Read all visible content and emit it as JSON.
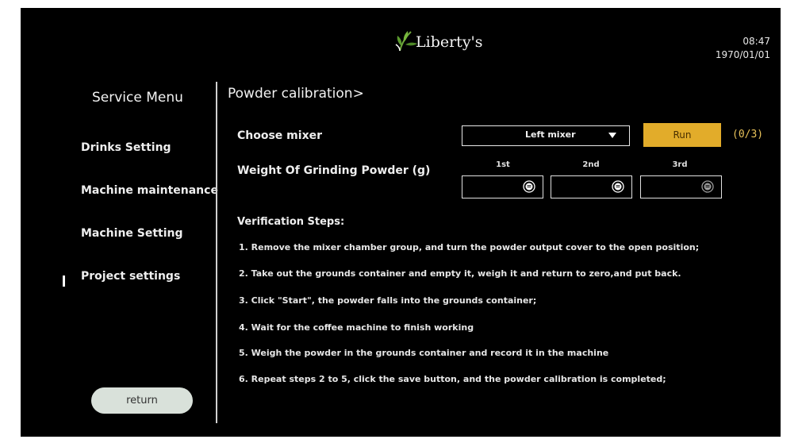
{
  "header": {
    "brand": "Liberty's",
    "time": "08:47",
    "date": "1970/01/01"
  },
  "sidebar": {
    "title": "Service Menu",
    "items": [
      {
        "label": "Drinks Setting"
      },
      {
        "label": "Machine maintenance"
      },
      {
        "label": "Machine Setting"
      },
      {
        "label": "Project settings",
        "active": true
      }
    ],
    "return_label": "return"
  },
  "main": {
    "title": "Powder calibration>",
    "choose_mixer_label": "Choose mixer",
    "mixer_value": "Left mixer",
    "run_label": "Run",
    "counter": "(0/3)",
    "weight_label": "Weight Of Grinding Powder (g)",
    "trials": [
      {
        "label": "1st",
        "value": ""
      },
      {
        "label": "2nd",
        "value": ""
      },
      {
        "label": "3rd",
        "value": ""
      }
    ],
    "steps_title": "Verification Steps:",
    "steps": [
      "1. Remove the mixer chamber group, and turn the powder output cover to the open position;",
      "2. Take out the grounds container and empty it, weigh it and return to zero,and put back.",
      "3. Click \"Start\", the powder falls into the grounds container;",
      "4. Wait for the coffee machine to finish working",
      "5. Weigh the powder in the grounds container and record it in the machine",
      "6. Repeat steps 2 to 5, click the save button, and the powder calibration is completed;"
    ]
  },
  "colors": {
    "background": "#000000",
    "run_button": "#e2ac2a",
    "counter_text": "#e9c35a",
    "return_button": "#d9e1da"
  },
  "icons": {
    "logo": "leaf-logo-icon",
    "dropdown": "triangle-down-icon",
    "weight_input": "keypad-icon"
  }
}
